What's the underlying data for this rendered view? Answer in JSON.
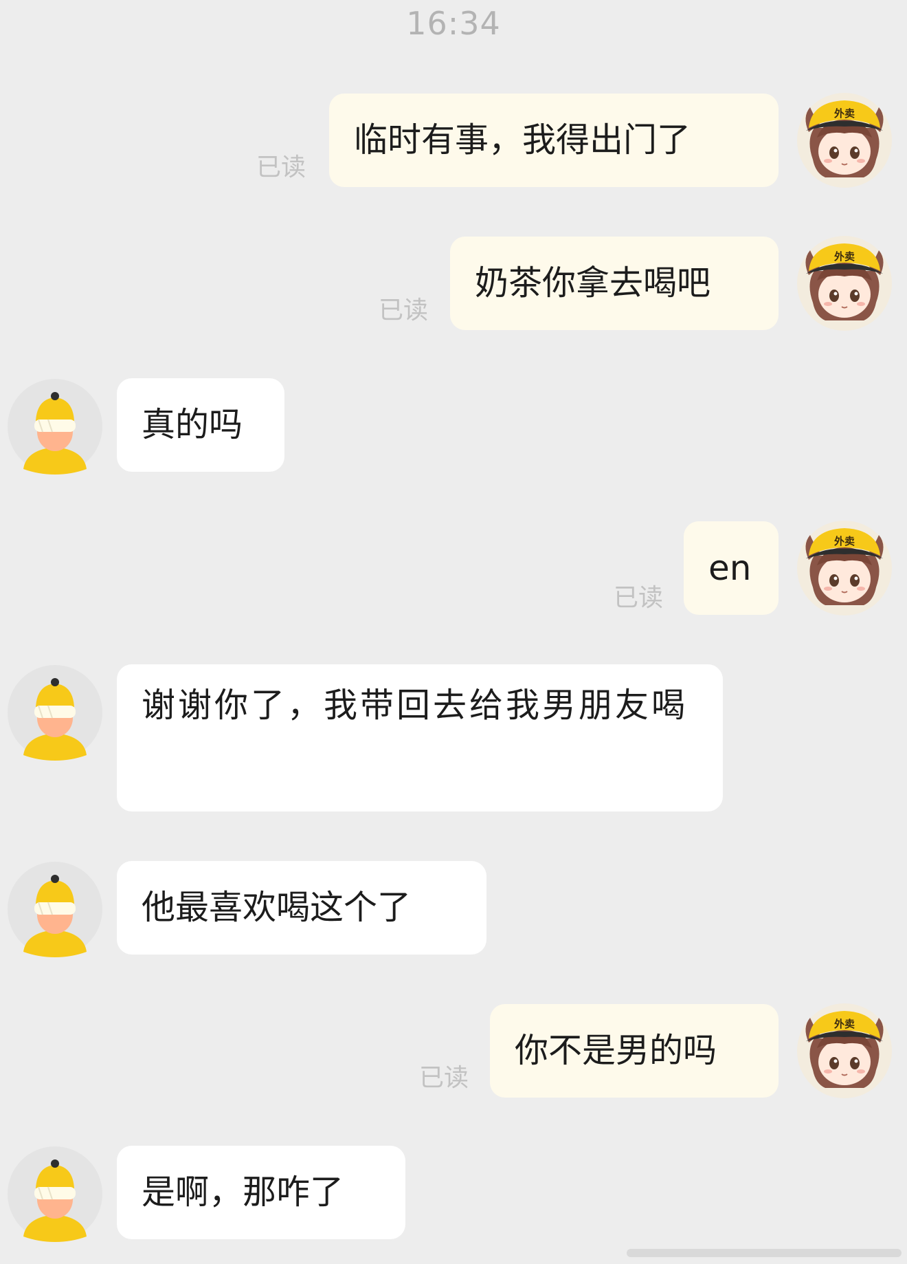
{
  "status": {
    "time": "16:34"
  },
  "messages": [
    {
      "side": "out",
      "text": "临时有事，我得出门了",
      "read": "已读"
    },
    {
      "side": "out",
      "text": "奶茶你拿去喝吧",
      "read": "已读"
    },
    {
      "side": "in",
      "text": "真的吗"
    },
    {
      "side": "out",
      "text": "en",
      "read": "已读"
    },
    {
      "side": "in",
      "text": "谢谢你了，我带回去给我男朋友喝"
    },
    {
      "side": "in",
      "text": "他最喜欢喝这个了"
    },
    {
      "side": "out",
      "text": "你不是男的吗",
      "read": "已读"
    },
    {
      "side": "in",
      "text": "是啊，那咋了"
    }
  ],
  "avatars": {
    "self_icon": "delivery-girl-icon",
    "self_cap_text": "外卖",
    "other_icon": "user-avatar-icon"
  },
  "colors": {
    "background": "#ededed",
    "outgoing_bubble": "#fefaeb",
    "incoming_bubble": "#ffffff",
    "read_text": "#c2c2c2",
    "time_text": "#b3b3b3",
    "accent_yellow": "#f7c919"
  }
}
